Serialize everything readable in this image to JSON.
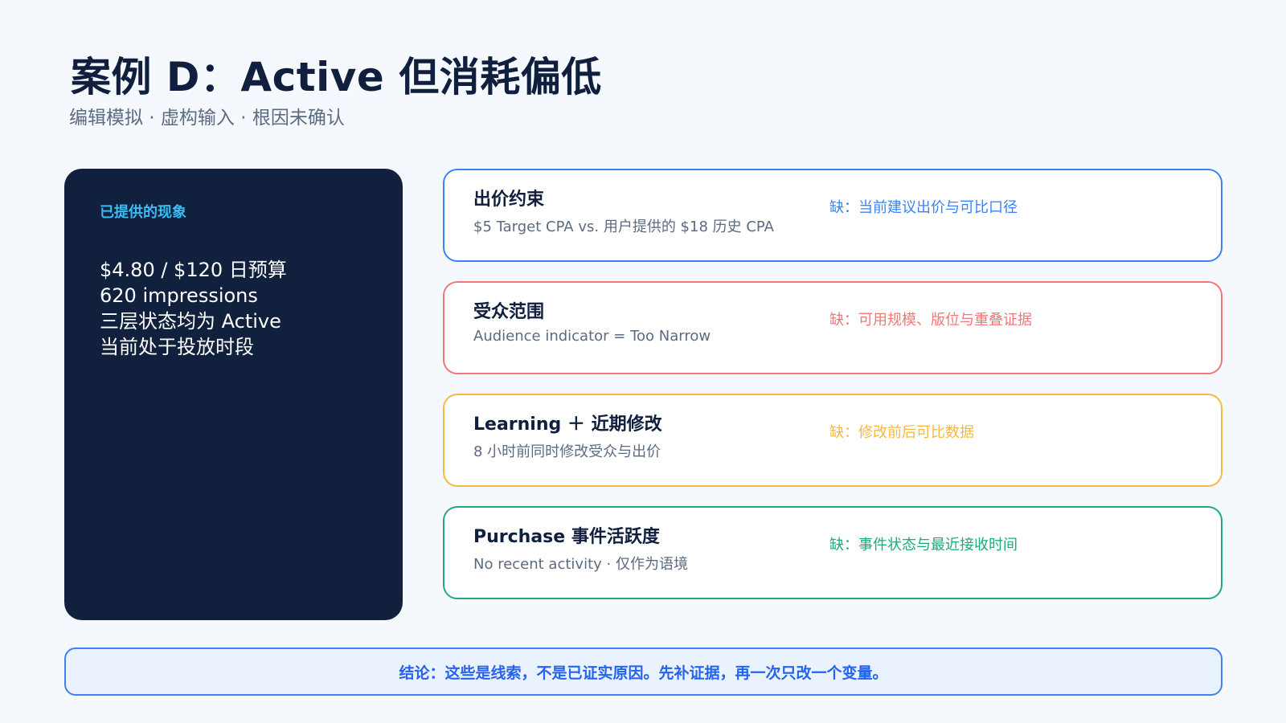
{
  "header": {
    "title": "案例 D：Active 但消耗偏低",
    "subtitle": "编辑模拟 · 虚构输入 · 根因未确认"
  },
  "facts": {
    "heading": "已提供的现象",
    "items": [
      "$4.80 / $120 日预算",
      "620 impressions",
      "三层状态均为 Active",
      "当前处于投放时段"
    ]
  },
  "cards": [
    {
      "title": "出价约束",
      "desc": "$5 Target CPA vs. 用户提供的 $18 历史 CPA",
      "missing": "缺：当前建议出价与可比口径",
      "color": "#3b82f6"
    },
    {
      "title": "受众范围",
      "desc": "Audience indicator = Too Narrow",
      "missing": "缺：可用规模、版位与重叠证据",
      "color": "#f07878"
    },
    {
      "title": "Learning ＋ 近期修改",
      "desc": "8 小时前同时修改受众与出价",
      "missing": "缺：修改前后可比数据",
      "color": "#f5b942"
    },
    {
      "title": "Purchase 事件活跃度",
      "desc": "No recent activity · 仅作为语境",
      "missing": "缺：事件状态与最近接收时间",
      "color": "#1faa7a"
    }
  ],
  "conclusion": {
    "text": "结论：这些是线索，不是已证实原因。先补证据，再一次只改一个变量。"
  }
}
